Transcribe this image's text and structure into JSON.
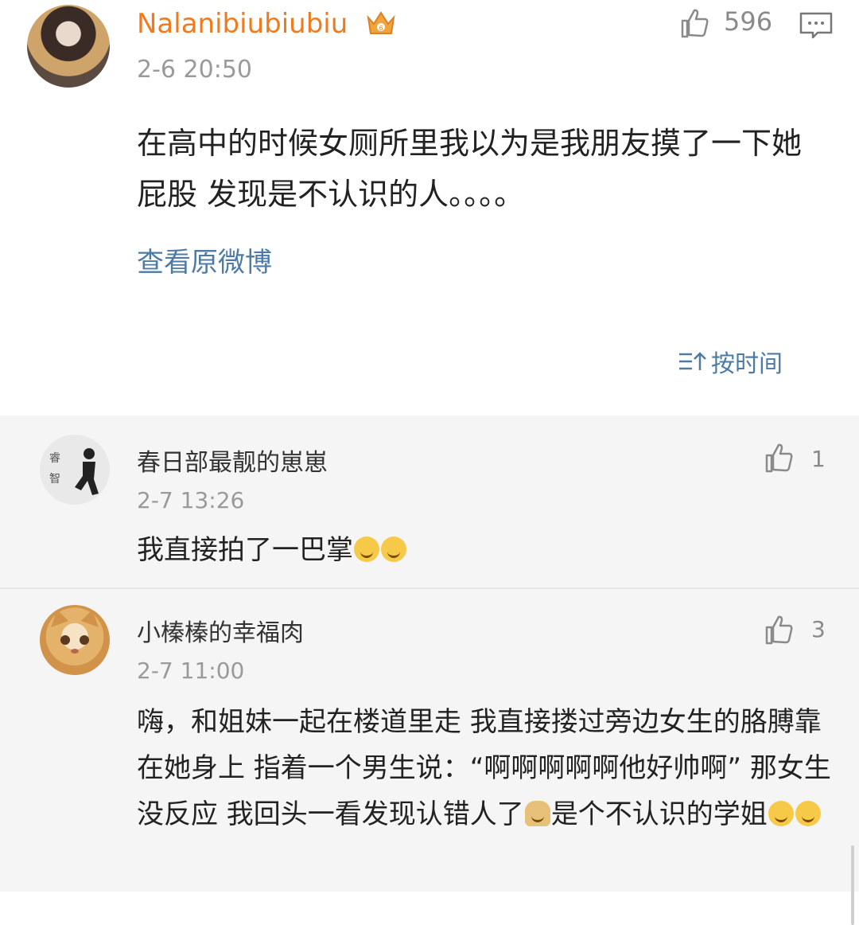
{
  "post": {
    "username": "Nalanibiubiubiu",
    "timestamp": "2-6 20:50",
    "like_count": "596",
    "text": "在高中的时候女厕所里我以为是我朋友摸了一下她屁股  发现是不认识的人。。。。",
    "view_original": "查看原微博",
    "sort_label": "按时间",
    "icons": {
      "badge": "crown-badge-icon",
      "like": "thumbs-up-icon",
      "comment": "comment-icon",
      "sort": "sort-icon"
    },
    "colors": {
      "username": "#f07a1e",
      "link": "#4d7ba6",
      "secondary": "#9a9a9a"
    }
  },
  "replies": [
    {
      "username": "春日部最靓的崽崽",
      "avatar_text": "睿智",
      "timestamp": "2-7 13:26",
      "like_count": "1",
      "text": "我直接拍了一巴掌",
      "emojis": [
        "laughing-crying-emoji",
        "laughing-crying-emoji"
      ]
    },
    {
      "username": "小榛榛的幸福肉",
      "timestamp": "2-7 11:00",
      "like_count": "3",
      "text_parts": [
        "嗨，和姐妹一起在楼道里走 我直接搂过旁边女生的胳膊靠在她身上 指着一个男生说：“啊啊啊啊啊他好帅啊” 那女生没反应 我回头一看发现认错人了",
        "是个不认识的学姐"
      ],
      "emojis": [
        "crying-person-emoji",
        "thinking-face-emoji",
        "thinking-face-emoji"
      ]
    }
  ]
}
